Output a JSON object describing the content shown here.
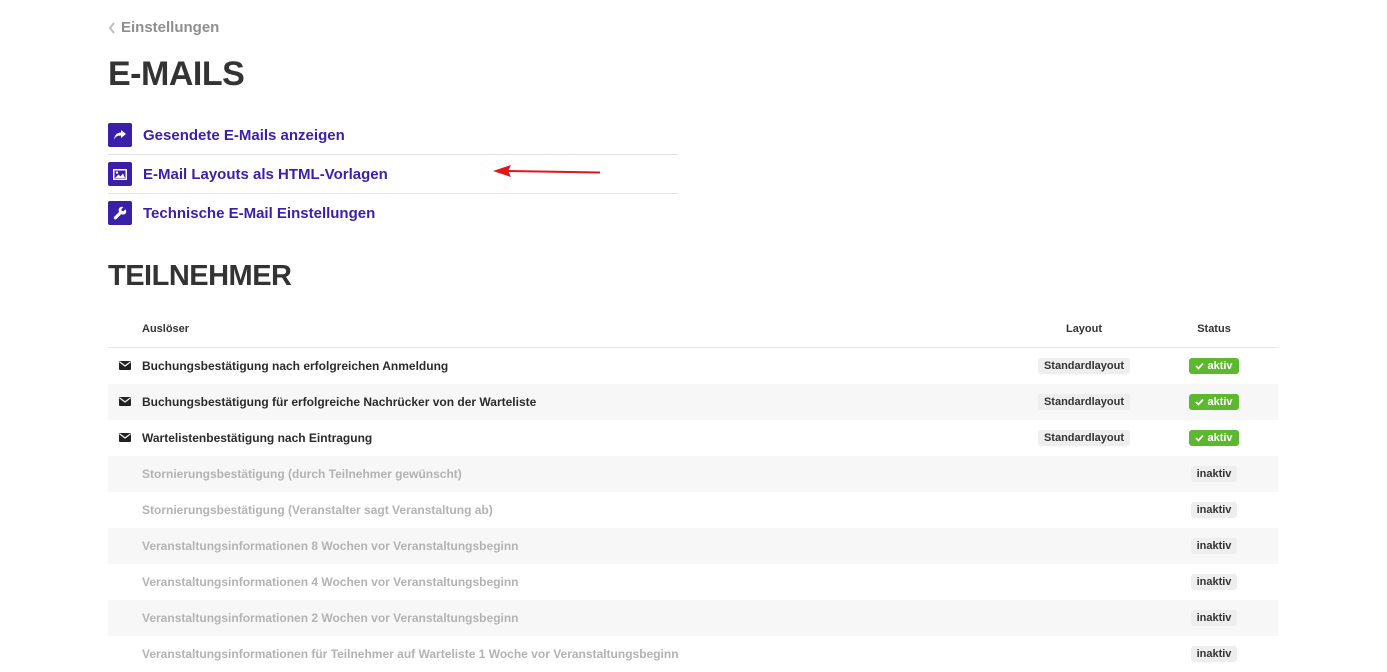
{
  "breadcrumb": {
    "label": "Einstellungen",
    "icon": "chevron-left-icon"
  },
  "page_title": "E-MAILS",
  "links": [
    {
      "label": "Gesendete E-Mails anzeigen",
      "icon": "share-arrow-icon"
    },
    {
      "label": "E-Mail Layouts als HTML-Vorlagen",
      "icon": "image-icon"
    },
    {
      "label": "Technische E-Mail Einstellungen",
      "icon": "wrench-icon"
    }
  ],
  "section_title": "TEILNEHMER",
  "table": {
    "headers": {
      "trigger": "Auslöser",
      "layout": "Layout",
      "status": "Status"
    },
    "rows": [
      {
        "name": "Buchungsbestätigung nach erfolgreichen Anmeldung",
        "layout": "Standardlayout",
        "status": "aktiv",
        "icon": "envelope-icon"
      },
      {
        "name": "Buchungsbestätigung für erfolgreiche Nachrücker von der Warteliste",
        "layout": "Standardlayout",
        "status": "aktiv",
        "icon": "envelope-icon"
      },
      {
        "name": "Wartelistenbestätigung nach Eintragung",
        "layout": "Standardlayout",
        "status": "aktiv",
        "icon": "envelope-icon"
      },
      {
        "name": "Stornierungsbestätigung (durch Teilnehmer gewünscht)",
        "layout": "",
        "status": "inaktiv"
      },
      {
        "name": "Stornierungsbestätigung (Veranstalter sagt Veranstaltung ab)",
        "layout": "",
        "status": "inaktiv"
      },
      {
        "name": "Veranstaltungsinformationen 8 Wochen vor Veranstaltungsbeginn",
        "layout": "",
        "status": "inaktiv"
      },
      {
        "name": "Veranstaltungsinformationen 4 Wochen vor Veranstaltungsbeginn",
        "layout": "",
        "status": "inaktiv"
      },
      {
        "name": "Veranstaltungsinformationen 2 Wochen vor Veranstaltungsbeginn",
        "layout": "",
        "status": "inaktiv"
      },
      {
        "name": "Veranstaltungsinformationen für Teilnehmer auf Warteliste 1 Woche vor Veranstaltungsbeginn",
        "layout": "",
        "status": "inaktiv"
      }
    ]
  },
  "colors": {
    "accent": "#3b1fa8",
    "active": "#5cb82e",
    "annotation_arrow": "#e0161b"
  }
}
